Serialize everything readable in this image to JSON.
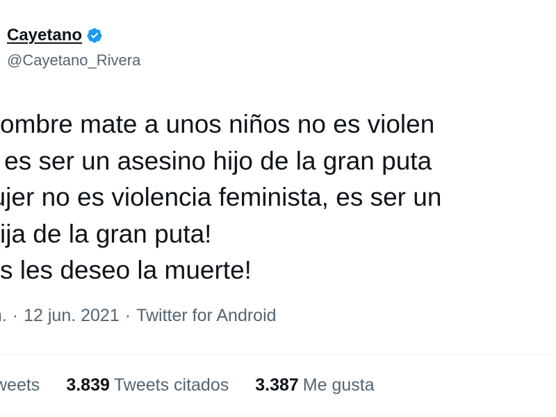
{
  "author": {
    "name": "Cayetano",
    "handle": "@Cayetano_Rivera",
    "verified_icon": "verified-badge-icon",
    "verified_color": "#1d9bf0"
  },
  "tweet": {
    "lines": [
      "un hombre mate a unos niños no es violen",
      "ista, es ser un asesino hijo de la gran puta",
      "s mujer no es violencia feminista, es ser un",
      "na hija de la gran puta!",
      "mbos les deseo la muerte!"
    ]
  },
  "meta": {
    "time": "m.",
    "separator": "·",
    "date": "12 jun. 2021",
    "source": "Twitter for Android"
  },
  "stats": {
    "retweets_label": "weets",
    "quotes_count": "3.839",
    "quotes_label": "Tweets citados",
    "likes_count": "3.387",
    "likes_label": "Me gusta"
  },
  "colors": {
    "text": "#0f1419",
    "secondary": "#536471",
    "divider": "#eff3f4"
  }
}
